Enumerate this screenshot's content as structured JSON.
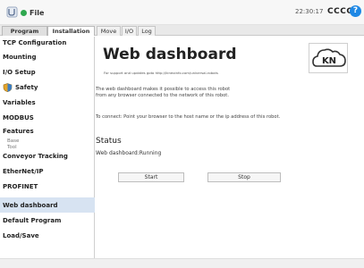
{
  "header": {
    "file_label": "File",
    "time": "22:30:17",
    "robot_name": "CCCC",
    "help_label": "?"
  },
  "tabs": [
    "Program",
    "Installation"
  ],
  "subtabs": [
    "Move",
    "I/O",
    "Log"
  ],
  "sidebar": {
    "items": [
      "TCP Configuration",
      "Mounting",
      "I/O Setup",
      "Safety",
      "Variables",
      "MODBUS",
      "Features",
      "Base",
      "Tool",
      "Conveyor Tracking",
      "EtherNet/IP",
      "PROFINET",
      "Web dashboard",
      "Default Program",
      "Load/Save"
    ],
    "active": "Web dashboard"
  },
  "main": {
    "title": "Web dashboard",
    "support_note": "For support and updates goto http://kineoinfo.com/universal-robots",
    "logo_text": "KN",
    "description_line1": "The web dashboard makes it possible to access this robot",
    "description_line2": "from any browser connected to the network of this robot.",
    "connect_text": "To connect: Point your browser to the host name or the ip address of this robot.",
    "status_heading": "Status",
    "status_value": "Web dashboard:Running",
    "start_label": "Start",
    "stop_label": "Stop"
  },
  "colors": {
    "accent": "#1e88e5",
    "active_item": "#d7e3f2",
    "status_dot": "#2fa84f"
  }
}
